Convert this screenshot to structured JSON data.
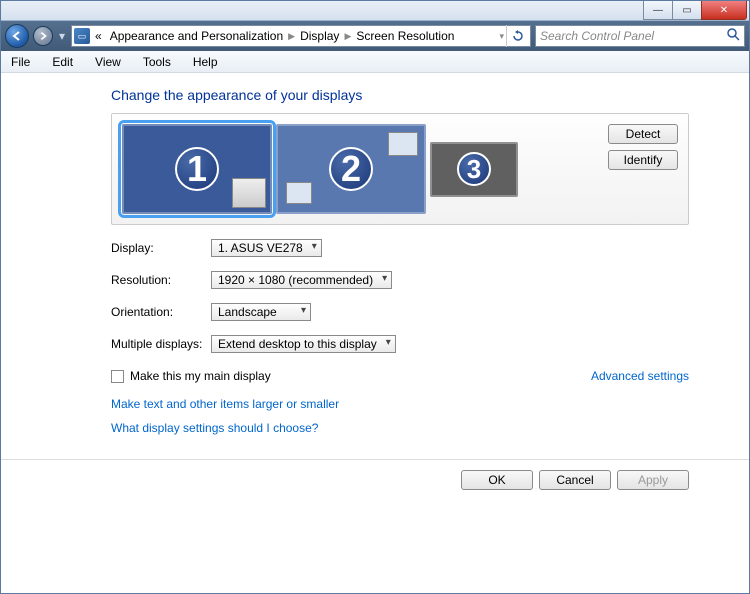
{
  "window_controls": {
    "minimize": "—",
    "maximize": "▭",
    "close": "✕"
  },
  "nav": {
    "crumbs_prefix": "«",
    "crumb1": "Appearance and Personalization",
    "crumb2": "Display",
    "crumb3": "Screen Resolution",
    "search_placeholder": "Search Control Panel"
  },
  "menus": {
    "file": "File",
    "edit": "Edit",
    "view": "View",
    "tools": "Tools",
    "help": "Help"
  },
  "heading": "Change the appearance of your displays",
  "monitors": {
    "m1": "1",
    "m2": "2",
    "m3": "3"
  },
  "side_buttons": {
    "detect": "Detect",
    "identify": "Identify"
  },
  "labels": {
    "display": "Display:",
    "resolution": "Resolution:",
    "orientation": "Orientation:",
    "multiple": "Multiple displays:"
  },
  "values": {
    "display": "1. ASUS VE278",
    "resolution": "1920 × 1080 (recommended)",
    "orientation": "Landscape",
    "multiple": "Extend desktop to this display"
  },
  "checkbox_label": "Make this my main display",
  "advanced_link": "Advanced settings",
  "link_larger": "Make text and other items larger or smaller",
  "link_which": "What display settings should I choose?",
  "buttons": {
    "ok": "OK",
    "cancel": "Cancel",
    "apply": "Apply"
  }
}
